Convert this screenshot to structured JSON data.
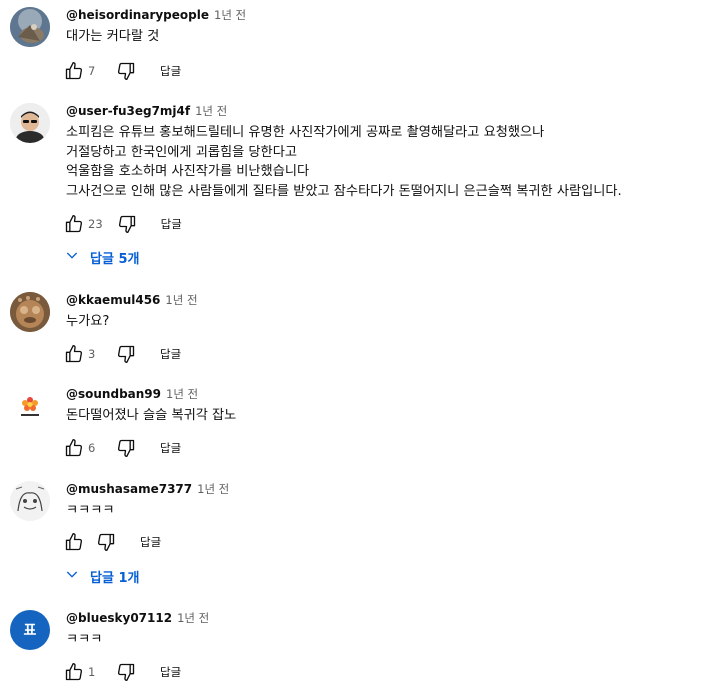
{
  "comments": [
    {
      "author": "@heisordinarypeople",
      "time": "1년 전",
      "text": "대가는 커다랄 것",
      "likes": "7",
      "reply_label": "답글"
    },
    {
      "author": "@user-fu3eg7mj4f",
      "time": "1년 전",
      "text": "소피킴은 유튜브 홍보해드릴테니 유명한 사진작가에게 공짜로 촬영해달라고 요청했으나\n거절당하고 한국인에게 괴롭힘을 당한다고\n억울함을 호소하며 사진작가를 비난했습니다\n그사건으로 인해 많은 사람들에게 질타를 받았고 잠수타다가 돈떨어지니 은근슬쩍 복귀한 사람입니다.",
      "likes": "23",
      "reply_label": "답글",
      "replies_label": "답글 5개"
    },
    {
      "author": "@kkaemul456",
      "time": "1년 전",
      "text": "누가요?",
      "likes": "3",
      "reply_label": "답글"
    },
    {
      "author": "@soundban99",
      "time": "1년 전",
      "text": "돈다떨어졌나 슬슬 복귀각 잡노",
      "likes": "6",
      "reply_label": "답글"
    },
    {
      "author": "@mushasame7377",
      "time": "1년 전",
      "text": "ㅋㅋㅋㅋ",
      "likes": "",
      "reply_label": "답글",
      "replies_label": "답글 1개"
    },
    {
      "author": "@bluesky07112",
      "time": "1년 전",
      "text": "ㅋㅋㅋ",
      "likes": "1",
      "reply_label": "답글",
      "avatar_initial": "표"
    }
  ],
  "colors": {
    "link_blue": "#065fd4",
    "secondary_text": "#606060",
    "avatar_blue": "#1565c0"
  },
  "icons": {
    "like": "thumb-up-icon",
    "dislike": "thumb-down-icon",
    "expand": "chevron-down-icon"
  }
}
